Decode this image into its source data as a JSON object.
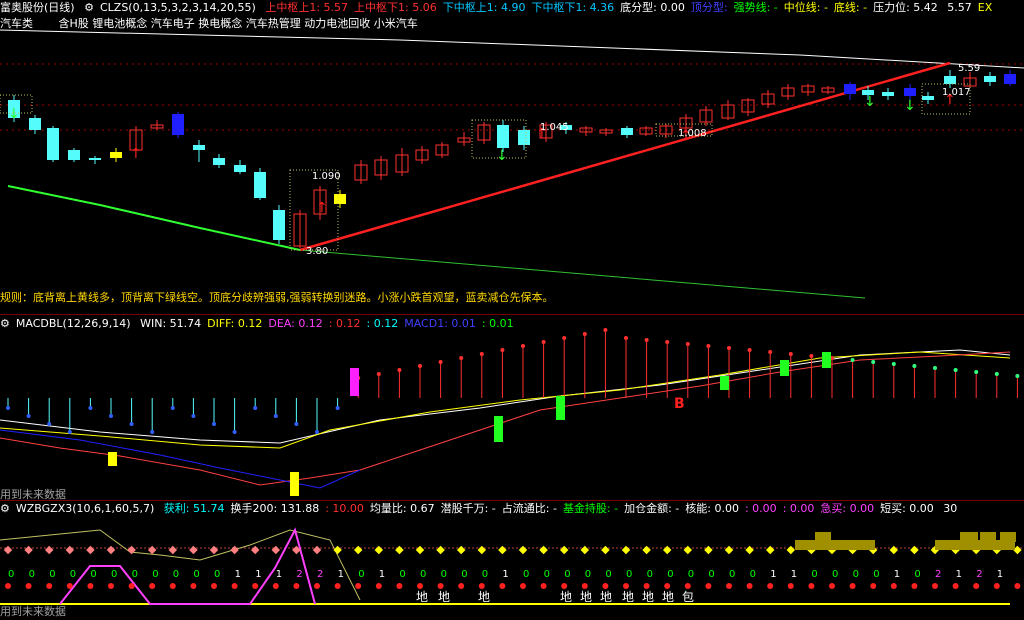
{
  "header1": {
    "title": "富奥股份(日线)",
    "indicator": "CLZS(0,13,5,3,2,3,14,20,55)",
    "items": [
      {
        "label": "上中枢上1:",
        "value": "5.57",
        "color": "#ff3030"
      },
      {
        "label": "上中枢下1:",
        "value": "5.06",
        "color": "#ff3030"
      },
      {
        "label": "下中枢上1:",
        "value": "4.90",
        "color": "#00c8ff"
      },
      {
        "label": "下中枢下1:",
        "value": "4.36",
        "color": "#00c8ff"
      },
      {
        "label": "底分型:",
        "value": "0.00",
        "color": "#ffffff"
      },
      {
        "label": "顶分型:",
        "value": "",
        "color": "#4040ff"
      },
      {
        "label": "强势线:",
        "value": "-",
        "color": "#00ff00"
      },
      {
        "label": "中位线:",
        "value": "-",
        "color": "#ffff00"
      },
      {
        "label": "底线:",
        "value": "-",
        "color": "#ffff00"
      },
      {
        "label": "压力位:",
        "value": "5.42",
        "color": "#ffffff"
      },
      {
        "label": "",
        "value": "5.57",
        "color": "#ffffff"
      },
      {
        "label": "EX",
        "value": "",
        "color": "#ffff00"
      }
    ]
  },
  "concepts": {
    "label": "汽车类",
    "list": "含H股 锂电池概念 汽车电子 换电概念 汽车热管理 动力电池回收 小米汽车"
  },
  "price_labels": {
    "high": "5.59",
    "low": "3.80",
    "p1": "1.090",
    "p2": "1.045",
    "p3": "1.008",
    "p4": "1.017"
  },
  "rule_text": "规则：底背离上黄线多，顶背离下绿线空。顶底分歧辨强弱,强弱转换别迷路。小涨小跌首观望，蓝卖减仓先保本。",
  "header2": {
    "indicator": "MACDBL(12,26,9,14)",
    "items": [
      {
        "label": "WIN:",
        "value": "51.74",
        "color": "#ffffff"
      },
      {
        "label": "DIFF:",
        "value": "0.12",
        "color": "#ffff00"
      },
      {
        "label": "DEA:",
        "value": "0.12",
        "color": "#ff40ff"
      },
      {
        "label": ":",
        "value": "0.12",
        "color": "#ff3030"
      },
      {
        "label": ":",
        "value": "0.12",
        "color": "#00ffff"
      },
      {
        "label": "MACD1:",
        "value": "0.01",
        "color": "#4040ff"
      },
      {
        "label": ":",
        "value": "0.01",
        "color": "#00ff00"
      }
    ],
    "b_mark": "B",
    "future_text": "用到未来数据"
  },
  "header3": {
    "indicator": "WZBGZX3(10,6,1,60,5,7)",
    "items": [
      {
        "label": "获利:",
        "value": "51.74",
        "color": "#00ffff"
      },
      {
        "label": "换手200:",
        "value": "131.88",
        "color": "#ffffff"
      },
      {
        "label": ":",
        "value": "10.00",
        "color": "#ff3030"
      },
      {
        "label": "均量比:",
        "value": "0.67",
        "color": "#ffffff"
      },
      {
        "label": "潜股千万:",
        "value": "-",
        "color": "#ffffff"
      },
      {
        "label": "占流通比:",
        "value": "-",
        "color": "#ffffff"
      },
      {
        "label": "基金持股:",
        "value": "-",
        "color": "#00ff00"
      },
      {
        "label": "加仓金额:",
        "value": "-",
        "color": "#ffffff"
      },
      {
        "label": "核能:",
        "value": "0.00",
        "color": "#ffffff"
      },
      {
        "label": ":",
        "value": "0.00",
        "color": "#ff40ff"
      },
      {
        "label": ":",
        "value": "0.00",
        "color": "#ff40ff"
      },
      {
        "label": "急买:",
        "value": "0.00",
        "color": "#ff40ff"
      },
      {
        "label": "短买:",
        "value": "0.00",
        "color": "#ffffff"
      },
      {
        "label": "",
        "value": "30",
        "color": "#ffffff"
      }
    ],
    "digits": [
      "0",
      "0",
      "0",
      "0",
      "0",
      "0",
      "0",
      "0",
      "0",
      "0",
      "0",
      "1",
      "1",
      "1",
      "2",
      "2",
      "1",
      "0",
      "1",
      "0",
      "0",
      "0",
      "0",
      "0",
      "1",
      "0",
      "0",
      "0",
      "0",
      "0",
      "0",
      "0",
      "0",
      "0",
      "0",
      "0",
      "0",
      "1",
      "1",
      "0",
      "0",
      "0",
      "0",
      "1",
      "0",
      "2",
      "1",
      "2",
      "1"
    ],
    "ground_text": "地",
    "bao_text": "包",
    "future_text": "用到未来数据"
  }
}
